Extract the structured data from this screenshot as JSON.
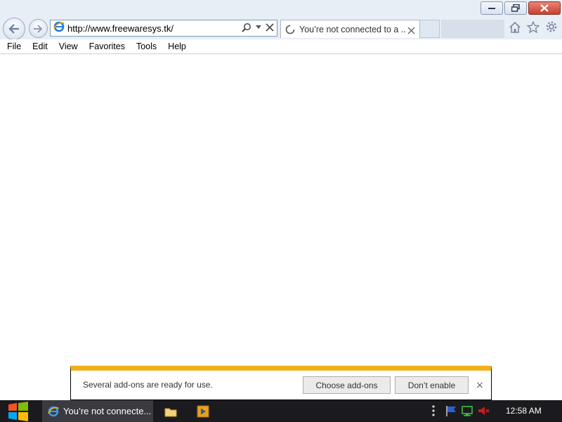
{
  "browser": {
    "address_value": "http://www.freewaresys.tk/",
    "tab_label": "You’re not connected to a ...",
    "menu": [
      "File",
      "Edit",
      "View",
      "Favorites",
      "Tools",
      "Help"
    ]
  },
  "icons": {
    "back": "back-arrow-icon",
    "forward": "forward-arrow-icon",
    "site": "internet-explorer-icon",
    "search": "search-icon",
    "dropdown": "chevron-down-icon",
    "stop": "close-icon",
    "loading": "loading-spinner-icon",
    "home": "home-icon",
    "favorites": "star-icon",
    "tools": "gear-icon"
  },
  "notification": {
    "message": "Several add-ons are ready for use.",
    "choose_label": "Choose add-ons",
    "dont_label": "Don’t enable",
    "close_glyph": "×",
    "accent": "#f0b21c"
  },
  "taskbar": {
    "ie_label": "You’re not connecte...",
    "clock": "12:58 AM",
    "background": "#1b1b1f"
  }
}
